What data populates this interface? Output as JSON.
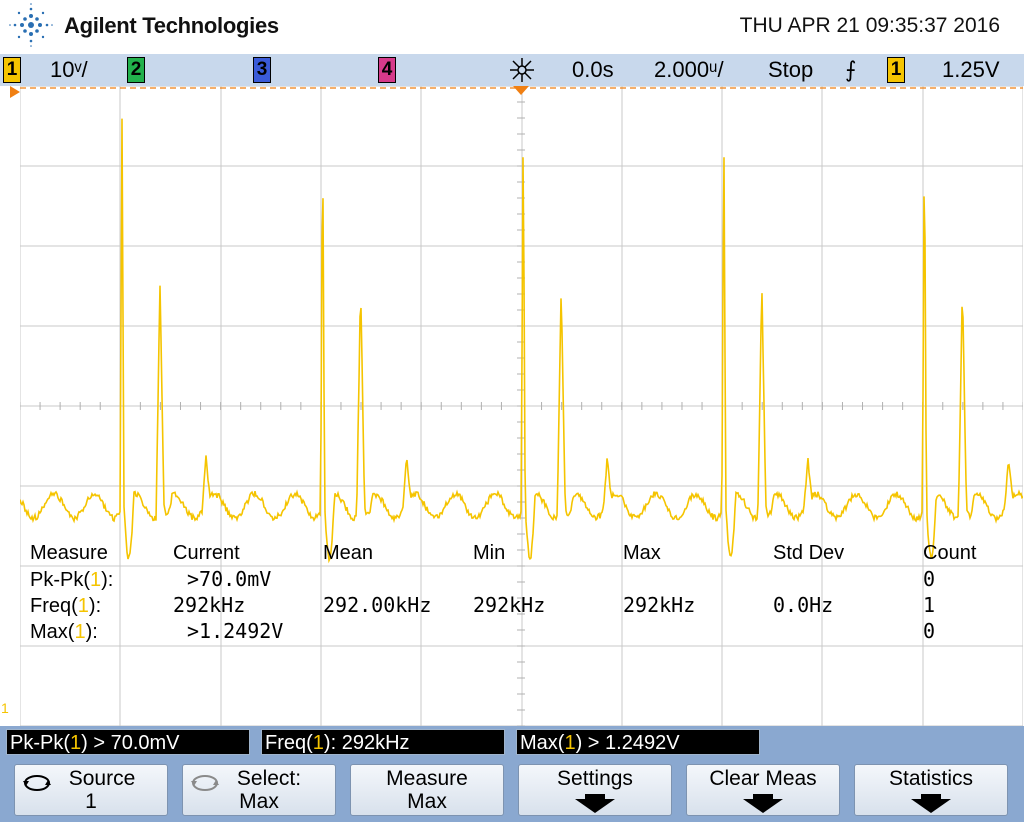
{
  "header": {
    "brand": "Agilent Technologies",
    "datetime": "THU APR 21 09:35:37 2016"
  },
  "status": {
    "ch1_num": "1",
    "ch1_scale": "10ᵛ/",
    "ch2_num": "2",
    "ch3_num": "3",
    "ch4_num": "4",
    "time_delay": "0.0s",
    "time_scale": "2.000ᵘ/",
    "run_state": "Stop",
    "trigger_slope_glyph": "⨍",
    "trigger_channel": "1",
    "trigger_level": "1.25V"
  },
  "colors": {
    "ch1": "#f5c400",
    "ch2": "#22b14c",
    "ch3": "#3a5bd9",
    "ch4": "#d63a8a",
    "trigger_marker": "#f07f12"
  },
  "markers": {
    "ground_label": "1"
  },
  "measure_table": {
    "headers": [
      "Measure",
      "Current",
      "Mean",
      "Min",
      "Max",
      "Std Dev",
      "Count"
    ],
    "rows": [
      {
        "name": "Pk-Pk(",
        "ch": "1",
        "close": "):",
        "current": ">70.0mV",
        "mean": "",
        "min": "",
        "max": "",
        "stddev": "",
        "count": "0"
      },
      {
        "name": "Freq(",
        "ch": "1",
        "close": "):",
        "current": "292kHz",
        "mean": "292.00kHz",
        "min": "292kHz",
        "max": "292kHz",
        "stddev": "0.0Hz",
        "count": "1"
      },
      {
        "name": "Max(",
        "ch": "1",
        "close": "):",
        "current": ">1.2492V",
        "mean": "",
        "min": "",
        "max": "",
        "stddev": "",
        "count": "0"
      }
    ]
  },
  "quick_meas": [
    {
      "prefix": "Pk-Pk(",
      "ch": "1",
      "suffix": ") > 70.0mV"
    },
    {
      "prefix": "Freq(",
      "ch": "1",
      "suffix": "): 292kHz"
    },
    {
      "prefix": "Max(",
      "ch": "1",
      "suffix": ") > 1.2492V"
    }
  ],
  "softkeys": [
    {
      "line1": "Source",
      "line2": "1",
      "icon": "rotary-knob-icon"
    },
    {
      "line1": "Select:",
      "line2": "Max",
      "icon": "rotary-knob-icon"
    },
    {
      "line1": "Measure",
      "line2": "Max"
    },
    {
      "line1": "Settings",
      "icon": "down-arrow-icon"
    },
    {
      "line1": "Clear Meas",
      "icon": "down-arrow-icon"
    },
    {
      "line1": "Statistics",
      "icon": "down-arrow-icon"
    }
  ]
}
